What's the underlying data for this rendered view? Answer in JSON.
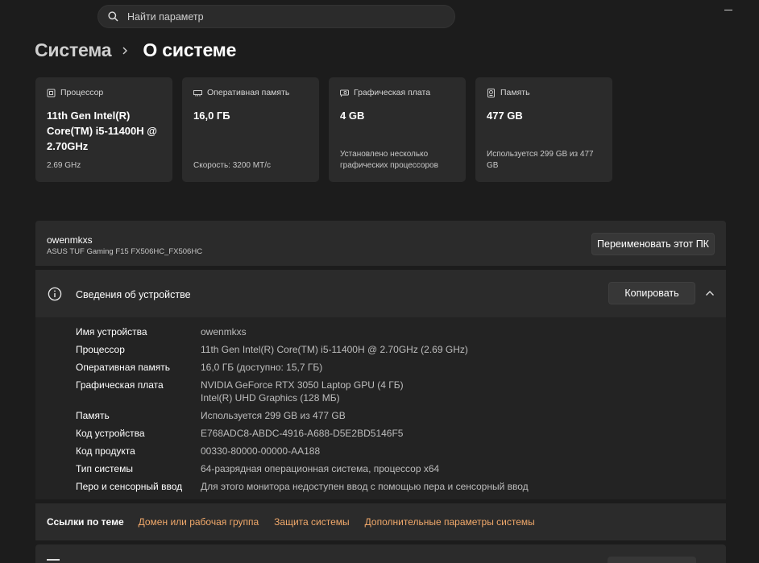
{
  "search": {
    "placeholder": "Найти параметр",
    "icon": "search-icon"
  },
  "breadcrumb": {
    "parent": "Система",
    "current": "О системе"
  },
  "cards": [
    {
      "icon": "processor-icon",
      "title": "Процессор",
      "value": "11th Gen Intel(R) Core(TM) i5-11400H @ 2.70GHz",
      "sub": "2.69 GHz"
    },
    {
      "icon": "memory-icon",
      "title": "Оперативная память",
      "value": "16,0 ГБ",
      "sub": "Скорость: 3200 МТ/с"
    },
    {
      "icon": "graphics-card-icon",
      "title": "Графическая плата",
      "value": "4 GB",
      "sub": "Установлено несколько графических процессоров"
    },
    {
      "icon": "storage-icon",
      "title": "Память",
      "value": "477 GB",
      "sub": "Используется 299 GB из 477 GB"
    }
  ],
  "device": {
    "name": "owenmkxs",
    "model": "ASUS TUF Gaming F15 FX506HC_FX506HC",
    "rename_label": "Переименовать этот ПК"
  },
  "info": {
    "title": "Сведения об устройстве",
    "copy_label": "Копировать",
    "rows": [
      {
        "label": "Имя устройства",
        "value": "owenmkxs"
      },
      {
        "label": "Процессор",
        "value": "11th Gen Intel(R) Core(TM) i5-11400H @ 2.70GHz (2.69 GHz)"
      },
      {
        "label": "Оперативная память",
        "value": "16,0 ГБ (доступно: 15,7 ГБ)"
      },
      {
        "label": "Графическая плата",
        "value": "NVIDIA GeForce RTX 3050 Laptop GPU (4 ГБ)",
        "value2": "Intel(R) UHD Graphics (128 МБ)"
      },
      {
        "label": "Память",
        "value": "Используется 299 GB из 477 GB"
      },
      {
        "label": "Код устройства",
        "value": "E768ADC8-ABDC-4916-A688-D5E2BD5146F5"
      },
      {
        "label": "Код продукта",
        "value": "00330-80000-00000-AA188"
      },
      {
        "label": "Тип системы",
        "value": "64-разрядная операционная система, процессор x64"
      },
      {
        "label": "Перо и сенсорный ввод",
        "value": "Для этого монитора недоступен ввод с помощью пера и сенсорный ввод"
      }
    ]
  },
  "links": {
    "title": "Ссылки по теме",
    "items": [
      "Домен или рабочая группа",
      "Защита системы",
      "Дополнительные параметры системы"
    ]
  },
  "colors": {
    "background": "#1c1c1c",
    "card": "#2b2b2b",
    "link": "#f0a86a"
  }
}
